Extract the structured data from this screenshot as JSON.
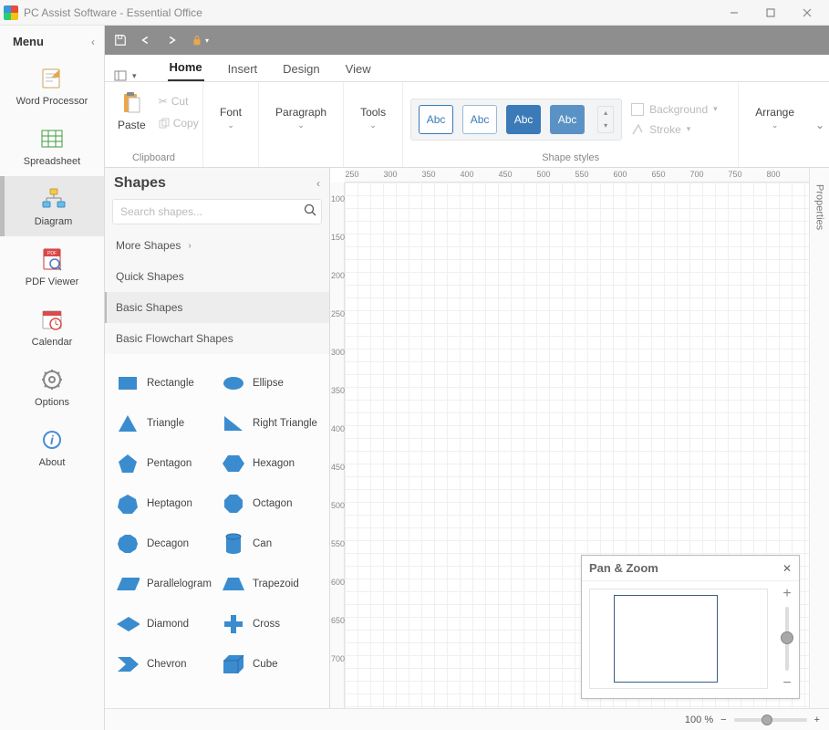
{
  "window": {
    "title": "PC Assist Software - Essential Office"
  },
  "sidemenu": {
    "header": "Menu",
    "items": [
      {
        "label": "Word Processor"
      },
      {
        "label": "Spreadsheet"
      },
      {
        "label": "Diagram"
      },
      {
        "label": "PDF Viewer"
      },
      {
        "label": "Calendar"
      },
      {
        "label": "Options"
      },
      {
        "label": "About"
      }
    ]
  },
  "tabs": [
    "Home",
    "Insert",
    "Design",
    "View"
  ],
  "ribbon": {
    "paste": "Paste",
    "cut": "Cut",
    "copy": "Copy",
    "clipboard_caption": "Clipboard",
    "font": "Font",
    "paragraph": "Paragraph",
    "tools": "Tools",
    "background": "Background",
    "stroke": "Stroke",
    "arrange": "Arrange",
    "shape_styles_caption": "Shape styles",
    "swatch_text": "Abc"
  },
  "shapes_panel": {
    "title": "Shapes",
    "search_placeholder": "Search shapes...",
    "categories": {
      "more": "More Shapes",
      "quick": "Quick Shapes",
      "basic": "Basic Shapes",
      "flow": "Basic Flowchart Shapes"
    },
    "shapes": [
      [
        "Rectangle",
        "Ellipse"
      ],
      [
        "Triangle",
        "Right Triangle"
      ],
      [
        "Pentagon",
        "Hexagon"
      ],
      [
        "Heptagon",
        "Octagon"
      ],
      [
        "Decagon",
        "Can"
      ],
      [
        "Parallelogram",
        "Trapezoid"
      ],
      [
        "Diamond",
        "Cross"
      ],
      [
        "Chevron",
        "Cube"
      ]
    ]
  },
  "ruler_h": [
    "250",
    "300",
    "350",
    "400",
    "450",
    "500",
    "550",
    "600",
    "650",
    "700",
    "750",
    "800"
  ],
  "ruler_v": [
    "100",
    "150",
    "200",
    "250",
    "300",
    "350",
    "400",
    "450",
    "500",
    "550",
    "600",
    "650",
    "700"
  ],
  "properties_tab": "Properties",
  "panzoom": {
    "title": "Pan & Zoom"
  },
  "status": {
    "zoom": "100 %"
  }
}
